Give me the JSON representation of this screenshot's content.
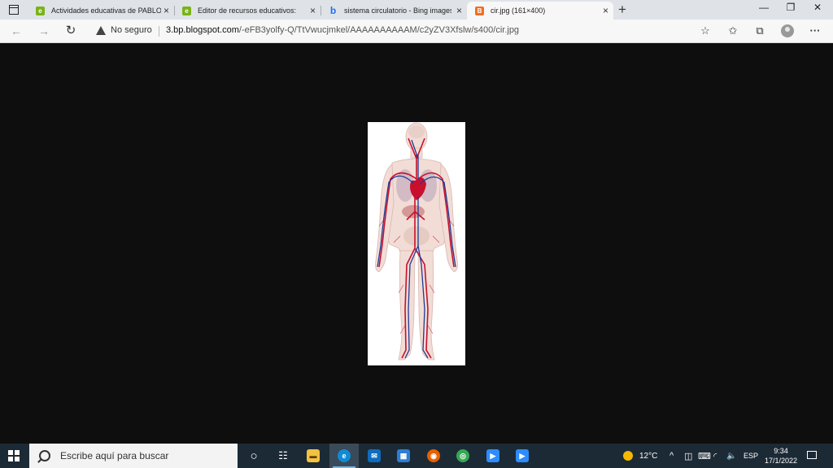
{
  "tabs": [
    {
      "title": "Actividades educativas de PABLO",
      "favicon_color": "#7ab317",
      "favicon_glyph": "e",
      "close": "×"
    },
    {
      "title": "Editor de recursos educativos:",
      "favicon_color": "#7ab317",
      "favicon_glyph": "e",
      "close": "×"
    },
    {
      "title": "sistema circulatorio - Bing images",
      "favicon_color": "#1a73e8",
      "favicon_glyph": "b",
      "close": "×"
    },
    {
      "title": "cir.jpg (161×400)",
      "favicon_color": "#f26e21",
      "favicon_glyph": "B",
      "close": "×",
      "active": true
    }
  ],
  "new_tab": "+",
  "window_controls": {
    "minimize": "—",
    "maximize": "❐",
    "close": "✕"
  },
  "nav": {
    "back": "←",
    "forward": "→",
    "refresh": "↻"
  },
  "address": {
    "security_label": "No seguro",
    "url_host": "3.bp.blogspot.com",
    "url_path": "/-eFB3yolfy-Q/TtVwucjmkel/AAAAAAAAAAM/c2yZV3Xfslw/s400/cir.jpg"
  },
  "toolbar_icons": {
    "favorite": "☆",
    "favorites": "✩",
    "collections": "⧉",
    "more": "···"
  },
  "image": {
    "alt": "cir.jpg",
    "natural_width": 161,
    "natural_height": 400
  },
  "taskbar": {
    "search_placeholder": "Escribe aquí para buscar",
    "apps": [
      {
        "name": "task-view",
        "glyph": "○",
        "color": "transparent"
      },
      {
        "name": "widgets",
        "glyph": "☷",
        "color": "transparent"
      },
      {
        "name": "file-explorer",
        "glyph": "▬",
        "color": "#f4c142"
      },
      {
        "name": "edge",
        "glyph": "e",
        "color": "#0f8bd6"
      },
      {
        "name": "mail",
        "glyph": "✉",
        "color": "#0f6cbd"
      },
      {
        "name": "store",
        "glyph": "▦",
        "color": "#2d7dd2"
      },
      {
        "name": "firefox",
        "glyph": "◉",
        "color": "#e66000"
      },
      {
        "name": "chrome",
        "glyph": "◎",
        "color": "#34a853"
      },
      {
        "name": "zoom",
        "glyph": "▶",
        "color": "#2d8cff"
      },
      {
        "name": "zoom-meetings",
        "glyph": "▶",
        "color": "#2d8cff"
      }
    ],
    "weather": "12°C",
    "tray_icons": {
      "chevron": "^",
      "network": "◫",
      "keyboard": "⌨",
      "wifi": "◜",
      "volume": "🔈"
    },
    "language": "ESP",
    "time": "9:34",
    "date": "17/1/2022"
  }
}
